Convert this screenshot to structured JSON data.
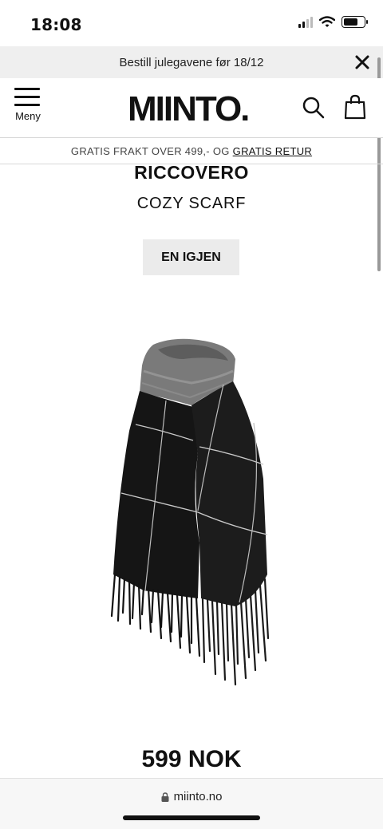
{
  "status_bar": {
    "time": "18:08",
    "battery_level": 0.7
  },
  "promo": {
    "text": "Bestill julegavene før 18/12",
    "close_icon": "close-icon"
  },
  "header": {
    "logo": "MIINTO.",
    "menu_label": "Meny",
    "search_icon": "search-icon",
    "bag_icon": "shopping-bag-icon"
  },
  "shipping": {
    "text": "GRATIS FRAKT OVER 499,- OG",
    "link": "GRATIS RETUR"
  },
  "product": {
    "brand": "RICCOVERO",
    "name": "COZY SCARF",
    "again_button": "EN IGJEN",
    "price": "599 NOK",
    "image_alt": "scarf-image"
  },
  "browser": {
    "url": "miinto.no"
  }
}
